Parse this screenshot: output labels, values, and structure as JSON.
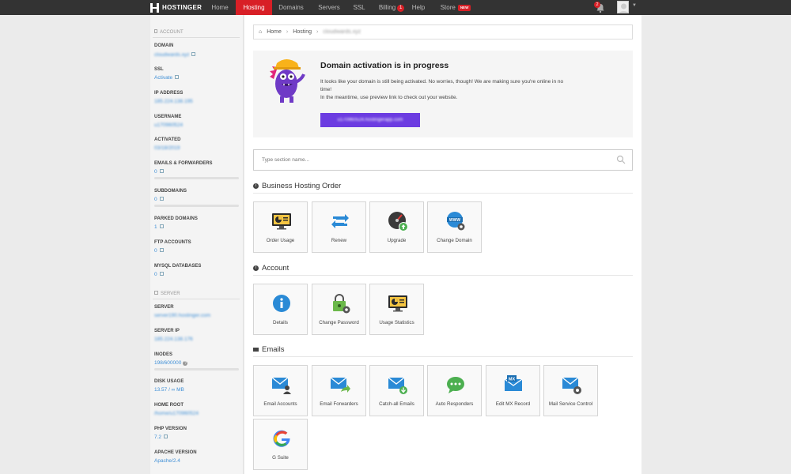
{
  "brand": "HOSTINGER",
  "nav": {
    "home": "Home",
    "hosting": "Hosting",
    "domains": "Domains",
    "servers": "Servers",
    "ssl": "SSL",
    "billing": "Billing",
    "billing_badge": "1",
    "help": "Help",
    "store": "Store",
    "store_badge": "NEW",
    "notifications_badge": "2"
  },
  "sidebar": {
    "account_section": "ACCOUNT",
    "domain_label": "DOMAIN",
    "domain_value": "cloudwards.xyz",
    "ssl_label": "SSL",
    "ssl_value": "Activate",
    "ip_label": "IP ADDRESS",
    "ip_value": "185.224.138.195",
    "username_label": "USERNAME",
    "username_value": "u170960524",
    "activated_label": "ACTIVATED",
    "activated_value": "03/18/2019",
    "emails_label": "EMAILS & FORWARDERS",
    "emails_value": "0",
    "subdomains_label": "SUBDOMAINS",
    "subdomains_value": "0",
    "parked_label": "PARKED DOMAINS",
    "parked_value": "1",
    "ftp_label": "FTP ACCOUNTS",
    "ftp_value": "0",
    "mysql_label": "MYSQL DATABASES",
    "mysql_value": "0",
    "server_section": "SERVER",
    "server_label": "SERVER",
    "server_value": "server190.hostinger.com",
    "server_ip_label": "SERVER IP",
    "server_ip_value": "185.224.138.176",
    "inodes_label": "INODES",
    "inodes_value": "198/600000",
    "disk_label": "DISK USAGE",
    "disk_value": "13.57 / ∞ MB",
    "home_root_label": "HOME ROOT",
    "home_root_value": "/home/u170960524",
    "php_label": "PHP VERSION",
    "php_value": "7.2",
    "apache_label": "APACHE VERSION",
    "apache_value": "Apache/2.4"
  },
  "breadcrumb": {
    "home": "Home",
    "hosting": "Hosting",
    "domain": "cloudwards.xyz"
  },
  "banner": {
    "title": "Domain activation is in progress",
    "line1": "It looks like your domain is still being activated. No worries, though! We are making sure you're online in no time!",
    "line2": "In the meantime, use preview link to check out your website.",
    "preview_link": "u170960524.hostingerapp.com"
  },
  "search": {
    "placeholder": "Type section name..."
  },
  "sections": {
    "order": "Business Hosting Order",
    "account": "Account",
    "emails": "Emails"
  },
  "tiles": {
    "order_usage": "Order Usage",
    "renew": "Renew",
    "upgrade": "Upgrade",
    "change_domain": "Change Domain",
    "details": "Details",
    "change_password": "Change Password",
    "usage_statistics": "Usage Statistics",
    "email_accounts": "Email Accounts",
    "email_forwarders": "Email Forwarders",
    "catch_all": "Catch-all Emails",
    "auto_responders": "Auto Responders",
    "edit_mx": "Edit MX Record",
    "mail_service": "Mail Service Control",
    "g_suite": "G Suite"
  },
  "colors": {
    "nav_bg": "#333333",
    "accent_red": "#d81f26",
    "brand_purple": "#6c3ce1",
    "link_blue": "#3f8fd6"
  }
}
